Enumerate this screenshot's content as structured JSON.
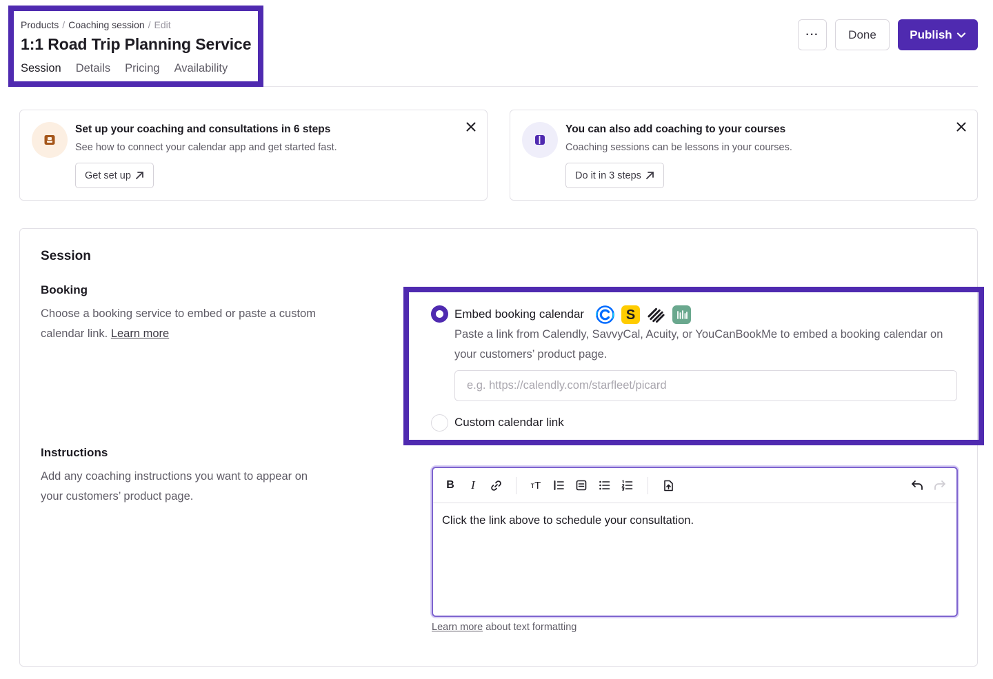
{
  "header": {
    "breadcrumb": [
      "Products",
      "Coaching session",
      "Edit"
    ],
    "separator": "/",
    "title": "1:1 Road Trip Planning Service",
    "tabs": [
      "Session",
      "Details",
      "Pricing",
      "Availability"
    ],
    "active_tab": "Session",
    "more_label": "···",
    "done_label": "Done",
    "publish_label": "Publish"
  },
  "cards": [
    {
      "icon": "calendar-badge-icon",
      "title": "Set up your coaching and consultations in 6 steps",
      "description": "See how to connect your calendar app and get started fast.",
      "button_label": "Get set up"
    },
    {
      "icon": "book-icon",
      "title": "You can also add coaching to your courses",
      "description": "Coaching sessions can be lessons in your courses.",
      "button_label": "Do it in 3 steps"
    }
  ],
  "session": {
    "title": "Session",
    "booking": {
      "title": "Booking",
      "description": "Choose a booking service to embed or paste a custom calendar link.",
      "learn_more": "Learn more",
      "options": [
        {
          "label": "Embed booking calendar",
          "selected": true,
          "description": "Paste a link from Calendly, SavvyCal, Acuity, or YouCanBookMe to embed a booking calendar on your customers’ product page.",
          "placeholder": "e.g. https://calendly.com/starfleet/picard",
          "value": ""
        },
        {
          "label": "Custom calendar link",
          "selected": false
        }
      ],
      "logos": [
        "calendly-logo",
        "savvycal-logo",
        "acuity-logo",
        "youcanbookme-logo"
      ]
    },
    "instructions": {
      "title": "Instructions",
      "description": "Add any coaching instructions you want to appear on your customers’ product page.",
      "toolbar": [
        "bold",
        "italic",
        "link",
        "text-size",
        "blockquote",
        "callout",
        "bullet-list",
        "numbered-list",
        "insert-file",
        "undo",
        "redo"
      ],
      "content": "Click the link above to schedule your consultation.",
      "help_link": "Learn more",
      "help_text": "about text formatting"
    }
  },
  "colors": {
    "accent": "#4f2ab0",
    "highlight_border": "#4f2ab0",
    "calendly": "#006bff",
    "savvycal": "#ffcc00",
    "youcanbookme": "#6aa88e"
  }
}
